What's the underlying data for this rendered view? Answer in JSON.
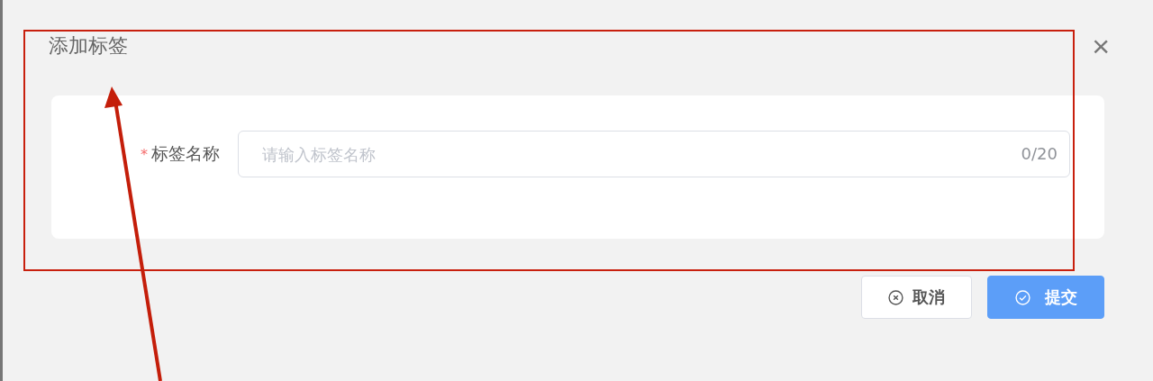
{
  "dialog": {
    "title": "添加标签",
    "close": "×"
  },
  "form": {
    "fields": [
      {
        "label": "标签名称",
        "required": true,
        "required_mark": "*",
        "placeholder": "请输入标签名称",
        "counter": "0/20"
      }
    ]
  },
  "buttons": [
    {
      "label": "取消",
      "kind": "cancel"
    },
    {
      "label": "提交",
      "kind": "submit"
    }
  ]
}
